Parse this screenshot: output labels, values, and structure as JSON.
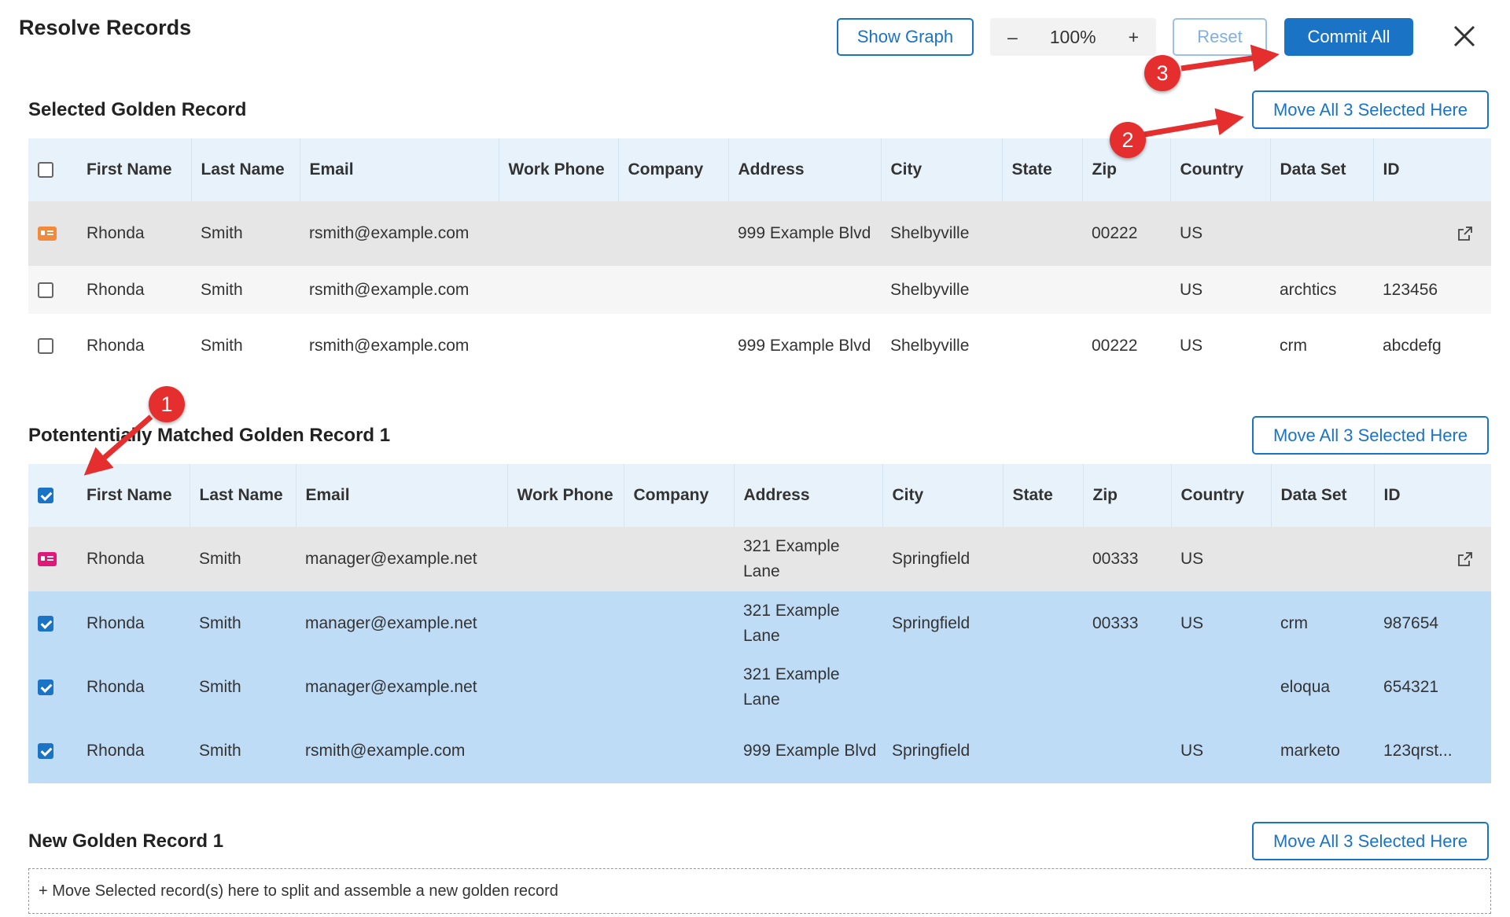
{
  "dialog": {
    "title": "Resolve Records",
    "show_graph_label": "Show Graph",
    "zoom_minus": "–",
    "zoom_level": "100%",
    "zoom_plus": "+",
    "reset_label": "Reset",
    "commit_all_label": "Commit All"
  },
  "columns": {
    "first_name": "First Name",
    "last_name": "Last Name",
    "email": "Email",
    "work_phone": "Work Phone",
    "company": "Company",
    "address": "Address",
    "city": "City",
    "state": "State",
    "zip": "Zip",
    "country": "Country",
    "data_set": "Data Set",
    "id": "ID"
  },
  "selected_golden": {
    "title": "Selected Golden Record",
    "move_label": "Move All 3 Selected Here",
    "rows": [
      {
        "first": "Rhonda",
        "last": "Smith",
        "email": "rsmith@example.com",
        "phone": "",
        "company": "",
        "address": "999 Example Blvd",
        "city": "Shelbyville",
        "state": "",
        "zip": "00222",
        "country": "US",
        "dataset": "",
        "id": ""
      },
      {
        "first": "Rhonda",
        "last": "Smith",
        "email": "rsmith@example.com",
        "phone": "",
        "company": "",
        "address": "",
        "city": "Shelbyville",
        "state": "",
        "zip": "",
        "country": "US",
        "dataset": "archtics",
        "id": "123456"
      },
      {
        "first": "Rhonda",
        "last": "Smith",
        "email": "rsmith@example.com",
        "phone": "",
        "company": "",
        "address": "999 Example Blvd",
        "city": "Shelbyville",
        "state": "",
        "zip": "00222",
        "country": "US",
        "dataset": "crm",
        "id": "abcdefg"
      }
    ]
  },
  "matched_golden": {
    "title": "Potententially Matched Golden Record 1",
    "move_label": "Move All 3 Selected Here",
    "rows": [
      {
        "first": "Rhonda",
        "last": "Smith",
        "email": "manager@example.net",
        "phone": "",
        "company": "",
        "address": "321 Example Lane",
        "city": "Springfield",
        "state": "",
        "zip": "00333",
        "country": "US",
        "dataset": "",
        "id": ""
      },
      {
        "first": "Rhonda",
        "last": "Smith",
        "email": "manager@example.net",
        "phone": "",
        "company": "",
        "address": "321 Example Lane",
        "city": "Springfield",
        "state": "",
        "zip": "00333",
        "country": "US",
        "dataset": "crm",
        "id": "987654"
      },
      {
        "first": "Rhonda",
        "last": "Smith",
        "email": "manager@example.net",
        "phone": "",
        "company": "",
        "address": "321 Example Lane",
        "city": "",
        "state": "",
        "zip": "",
        "country": "",
        "dataset": "eloqua",
        "id": "654321"
      },
      {
        "first": "Rhonda",
        "last": "Smith",
        "email": "rsmith@example.com",
        "phone": "",
        "company": "",
        "address": "999 Example Blvd",
        "city": "Springfield",
        "state": "",
        "zip": "",
        "country": "US",
        "dataset": "marketo",
        "id": "123qrst..."
      }
    ]
  },
  "new_golden": {
    "title": "New Golden Record 1",
    "move_label": "Move All 3 Selected Here",
    "drop_hint": "+ Move Selected record(s) here to split and assemble a new golden record"
  },
  "annotations": {
    "step1": "1",
    "step2": "2",
    "step3": "3"
  },
  "colors": {
    "accent": "#1a73c5",
    "selected_row": "#bfdcf7",
    "header_row": "#e8f2fa",
    "golden_icon_1": "#f28a3c",
    "golden_icon_2": "#e0187a",
    "annotation": "#e52e2e"
  }
}
